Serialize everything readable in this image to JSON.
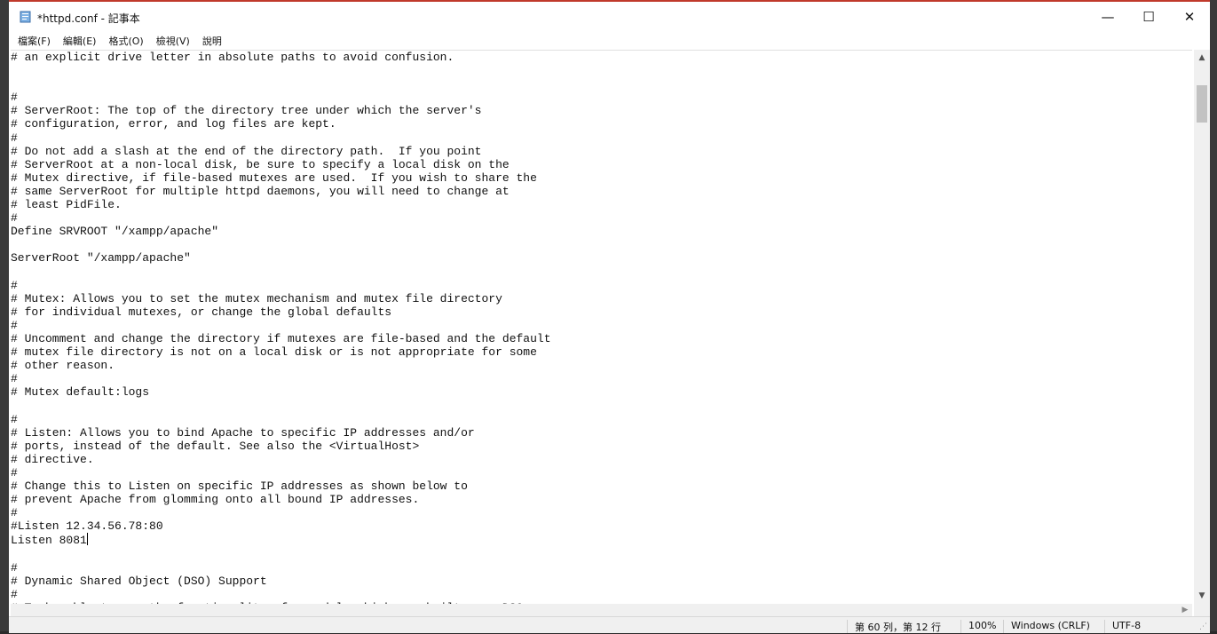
{
  "window": {
    "title": "*httpd.conf - 記事本",
    "icons": {
      "app": "notepad-icon",
      "minimize": "minimize-icon",
      "maximize": "maximize-icon",
      "close": "close-icon"
    }
  },
  "menu": {
    "items": [
      "檔案(F)",
      "編輯(E)",
      "格式(O)",
      "檢視(V)",
      "說明"
    ]
  },
  "editor": {
    "lines": [
      "# an explicit drive letter in absolute paths to avoid confusion.",
      "",
      "",
      "#",
      "# ServerRoot: The top of the directory tree under which the server's",
      "# configuration, error, and log files are kept.",
      "#",
      "# Do not add a slash at the end of the directory path.  If you point",
      "# ServerRoot at a non-local disk, be sure to specify a local disk on the",
      "# Mutex directive, if file-based mutexes are used.  If you wish to share the",
      "# same ServerRoot for multiple httpd daemons, you will need to change at",
      "# least PidFile.",
      "#",
      "Define SRVROOT \"/xampp/apache\"",
      "",
      "ServerRoot \"/xampp/apache\"",
      "",
      "#",
      "# Mutex: Allows you to set the mutex mechanism and mutex file directory",
      "# for individual mutexes, or change the global defaults",
      "#",
      "# Uncomment and change the directory if mutexes are file-based and the default",
      "# mutex file directory is not on a local disk or is not appropriate for some",
      "# other reason.",
      "#",
      "# Mutex default:logs",
      "",
      "#",
      "# Listen: Allows you to bind Apache to specific IP addresses and/or",
      "# ports, instead of the default. See also the <VirtualHost>",
      "# directive.",
      "#",
      "# Change this to Listen on specific IP addresses as shown below to",
      "# prevent Apache from glomming onto all bound IP addresses.",
      "#",
      "#Listen 12.34.56.78:80",
      "Listen 8081",
      "",
      "#",
      "# Dynamic Shared Object (DSO) Support",
      "#",
      "# To be able to use the functionality of a module which was built as a DSO you"
    ],
    "cursor_line_index": 36
  },
  "status": {
    "position": "第 60 列，第 12 行",
    "zoom": "100%",
    "line_ending": "Windows (CRLF)",
    "encoding": "UTF-8"
  },
  "colors": {
    "accent_border": "#c0392b",
    "editor_bg": "#ffffff",
    "text": "#111111"
  }
}
